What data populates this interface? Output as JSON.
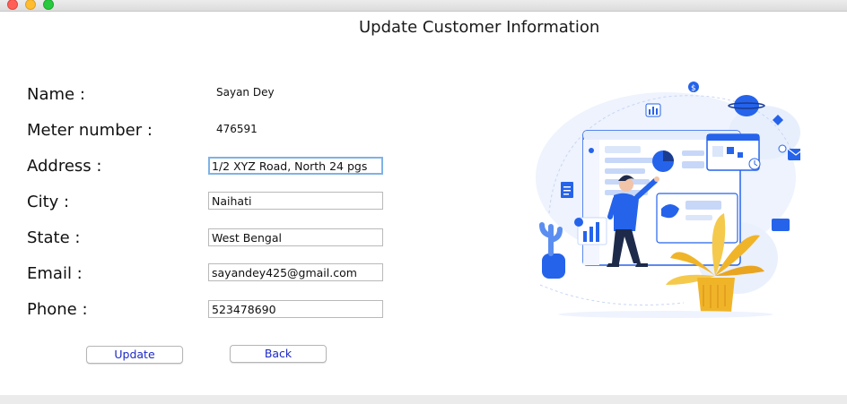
{
  "window": {
    "title": "Update Customer Information"
  },
  "form": {
    "name_label": "Name :",
    "name_value": "Sayan Dey",
    "meter_label": "Meter number :",
    "meter_value": "476591",
    "address_label": "Address :",
    "address_value": "1/2 XYZ Road, North 24 pgs",
    "city_label": "City :",
    "city_value": "Naihati",
    "state_label": "State :",
    "state_value": "West Bengal",
    "email_label": "Email :",
    "email_value": "sayandey425@gmail.com",
    "phone_label": "Phone :",
    "phone_value": "523478690"
  },
  "buttons": {
    "update": "Update",
    "back": "Back"
  },
  "colors": {
    "accent": "#2563eb",
    "button_text": "#1c29c6",
    "plant_yellow": "#f0b429"
  },
  "illustration": {
    "icon": "dashboard-analytics-illustration"
  }
}
